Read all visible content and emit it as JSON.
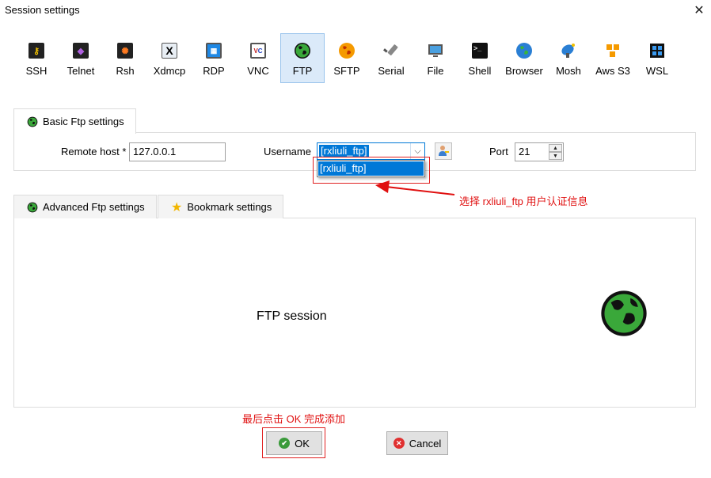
{
  "window": {
    "title": "Session settings",
    "close_symbol": "✕"
  },
  "protocols": [
    {
      "label": "SSH",
      "icon": "ssh-key-icon",
      "selected": false
    },
    {
      "label": "Telnet",
      "icon": "telnet-icon",
      "selected": false
    },
    {
      "label": "Rsh",
      "icon": "rsh-icon",
      "selected": false
    },
    {
      "label": "Xdmcp",
      "icon": "xdmcp-icon",
      "selected": false
    },
    {
      "label": "RDP",
      "icon": "rdp-icon",
      "selected": false
    },
    {
      "label": "VNC",
      "icon": "vnc-icon",
      "selected": false
    },
    {
      "label": "FTP",
      "icon": "ftp-globe-icon",
      "selected": true
    },
    {
      "label": "SFTP",
      "icon": "sftp-icon",
      "selected": false
    },
    {
      "label": "Serial",
      "icon": "serial-plug-icon",
      "selected": false
    },
    {
      "label": "File",
      "icon": "file-monitor-icon",
      "selected": false
    },
    {
      "label": "Shell",
      "icon": "shell-terminal-icon",
      "selected": false
    },
    {
      "label": "Browser",
      "icon": "browser-globe-icon",
      "selected": false
    },
    {
      "label": "Mosh",
      "icon": "mosh-antenna-icon",
      "selected": false
    },
    {
      "label": "Aws S3",
      "icon": "aws-s3-icon",
      "selected": false
    },
    {
      "label": "WSL",
      "icon": "wsl-windows-icon",
      "selected": false
    }
  ],
  "basic": {
    "tab_label": "Basic Ftp settings",
    "remote_host_label": "Remote host *",
    "remote_host_value": "127.0.0.1",
    "username_label": "Username",
    "username_value": "[rxliuli_ftp]",
    "username_options": [
      "[rxliuli_ftp]"
    ],
    "port_label": "Port",
    "port_value": "21"
  },
  "lower_tabs": [
    {
      "label": "Advanced Ftp settings",
      "icon": "globe-icon"
    },
    {
      "label": "Bookmark settings",
      "icon": "star-icon"
    }
  ],
  "session_panel": {
    "label": "FTP session"
  },
  "annotations": {
    "select_user": "选择 rxliuli_ftp 用户认证信息",
    "click_ok": "最后点击 OK 完成添加"
  },
  "buttons": {
    "ok_label": "OK",
    "cancel_label": "Cancel"
  },
  "colors": {
    "accent": "#0078d7",
    "annotation_red": "#e01010",
    "globe_green": "#2e8b2e",
    "selected_bg": "#dbeaf9"
  }
}
